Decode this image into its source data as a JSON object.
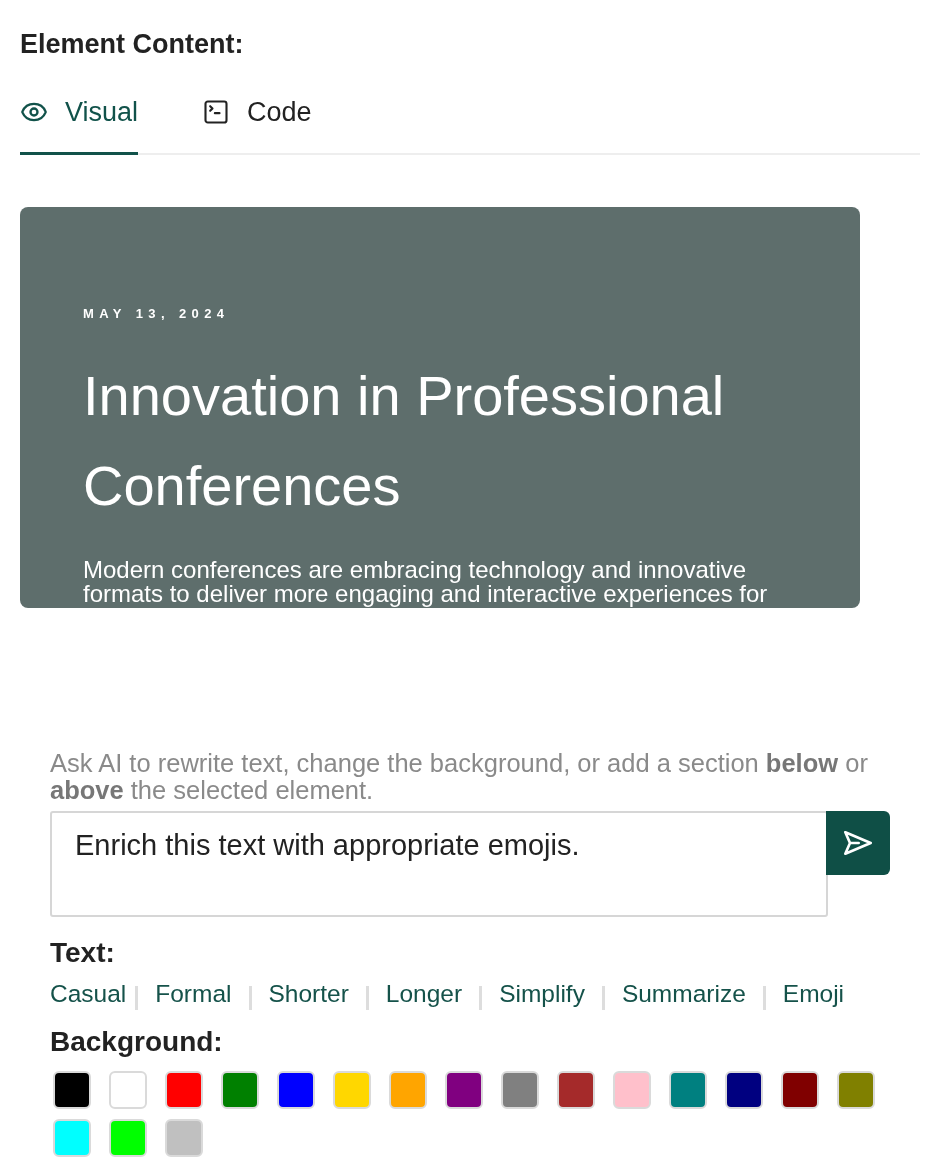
{
  "heading": "Element Content:",
  "tabs": [
    {
      "label": "Visual",
      "selected": true,
      "kind": "visual"
    },
    {
      "label": "Code",
      "selected": false,
      "kind": "code"
    }
  ],
  "preview": {
    "date": "MAY 13, 2024",
    "title": "Innovation in Professional Conferences",
    "body": "Modern conferences are embracing technology and innovative formats to deliver more engaging and interactive experiences for"
  },
  "prompt": {
    "hint": "Ask AI to rewrite text, change the background, or add a section **below** or **above** the selected element.",
    "value": "Enrich this text with appropriate emojis."
  },
  "text_options": {
    "label": "Text:",
    "items": [
      "Casual",
      "Formal",
      "Shorter",
      "Longer",
      "Simplify",
      "Summarize",
      "Emoji"
    ]
  },
  "background": {
    "label": "Background:",
    "swatches": [
      {
        "color": "#000000"
      },
      {
        "color": "#ffffff"
      },
      {
        "color": "#ff0000"
      },
      {
        "color": "#008000"
      },
      {
        "color": "#0000ff"
      },
      {
        "color": "#ffd700"
      },
      {
        "color": "#ffa500"
      },
      {
        "color": "#800080"
      },
      {
        "color": "#808080"
      },
      {
        "color": "#a52a2a"
      },
      {
        "color": "#ffc0cb"
      },
      {
        "color": "#008080"
      },
      {
        "color": "#000080"
      },
      {
        "color": "#800000"
      },
      {
        "color": "#808000"
      },
      {
        "color": "#00ffff"
      },
      {
        "color": "#00ff00"
      },
      {
        "color": "#c0c0c0"
      }
    ]
  }
}
